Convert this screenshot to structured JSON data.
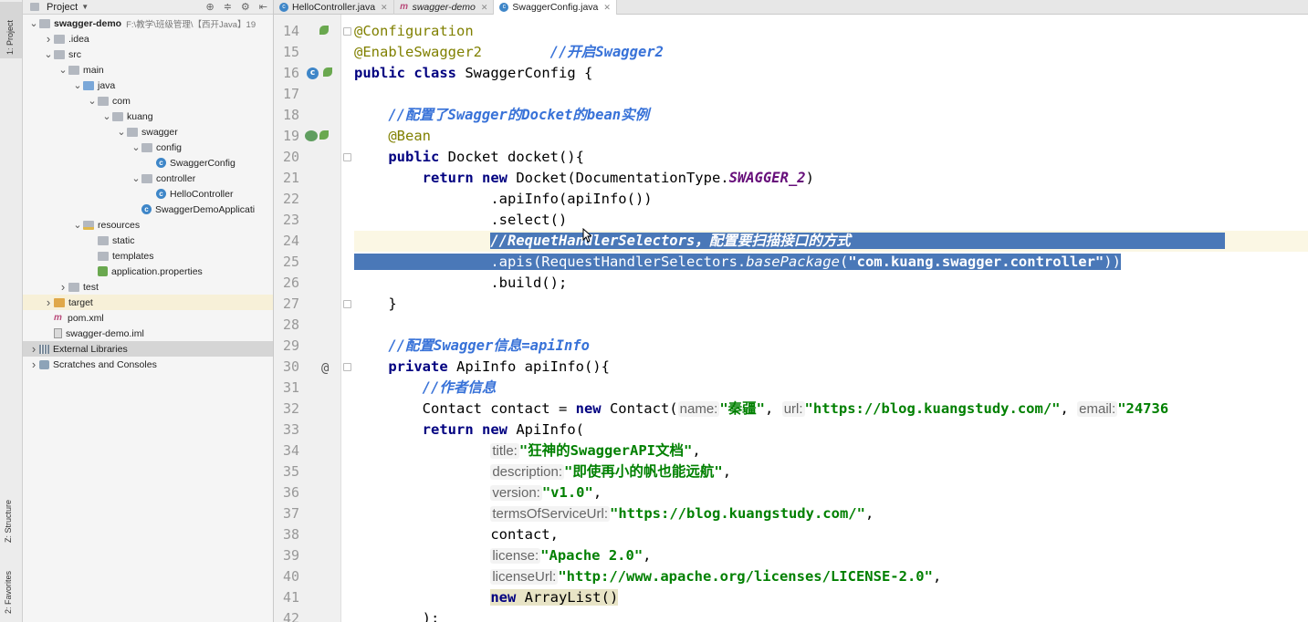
{
  "toolstrip": {
    "project_tab": "1: Project",
    "structure_tab": "Z: Structure",
    "favorites_tab": "2: Favorites"
  },
  "project_panel": {
    "title": "Project",
    "tree": [
      {
        "label": "swagger-demo",
        "path": "F:\\教学\\班级管理\\【西开Java】19",
        "depth": 0,
        "arrow": "down",
        "icon": "folder-icon"
      },
      {
        "label": ".idea",
        "depth": 1,
        "arrow": "right",
        "icon": "folder-icon"
      },
      {
        "label": "src",
        "depth": 1,
        "arrow": "down",
        "icon": "folder-icon"
      },
      {
        "label": "main",
        "depth": 2,
        "arrow": "down",
        "icon": "folder-icon"
      },
      {
        "label": "java",
        "depth": 3,
        "arrow": "down",
        "icon": "source-folder-icon"
      },
      {
        "label": "com",
        "depth": 4,
        "arrow": "down",
        "icon": "package-icon"
      },
      {
        "label": "kuang",
        "depth": 5,
        "arrow": "down",
        "icon": "package-icon"
      },
      {
        "label": "swagger",
        "depth": 6,
        "arrow": "down",
        "icon": "package-icon"
      },
      {
        "label": "config",
        "depth": 7,
        "arrow": "down",
        "icon": "package-icon"
      },
      {
        "label": "SwaggerConfig",
        "depth": 8,
        "arrow": "",
        "icon": "class-icon"
      },
      {
        "label": "controller",
        "depth": 7,
        "arrow": "down",
        "icon": "package-icon"
      },
      {
        "label": "HelloController",
        "depth": 8,
        "arrow": "",
        "icon": "class-icon"
      },
      {
        "label": "SwaggerDemoApplicati",
        "depth": 7,
        "arrow": "",
        "icon": "spring-class-icon"
      },
      {
        "label": "resources",
        "depth": 3,
        "arrow": "down",
        "icon": "resources-folder-icon"
      },
      {
        "label": "static",
        "depth": 4,
        "arrow": "",
        "icon": "folder-icon"
      },
      {
        "label": "templates",
        "depth": 4,
        "arrow": "",
        "icon": "folder-icon"
      },
      {
        "label": "application.properties",
        "depth": 4,
        "arrow": "",
        "icon": "properties-icon"
      },
      {
        "label": "test",
        "depth": 2,
        "arrow": "right",
        "icon": "folder-icon"
      },
      {
        "label": "target",
        "depth": 1,
        "arrow": "right",
        "icon": "target-folder-icon"
      },
      {
        "label": "pom.xml",
        "depth": 1,
        "arrow": "",
        "icon": "maven-icon"
      },
      {
        "label": "swagger-demo.iml",
        "depth": 1,
        "arrow": "",
        "icon": "iml-file-icon"
      },
      {
        "label": "External Libraries",
        "depth": 0,
        "arrow": "right",
        "icon": "libraries-icon"
      },
      {
        "label": "Scratches and Consoles",
        "depth": 0,
        "arrow": "right",
        "icon": "scratches-icon"
      }
    ]
  },
  "tabs": [
    {
      "label": "HelloController.java",
      "icon": "class-icon",
      "active": false
    },
    {
      "label": "swagger-demo",
      "icon": "maven-icon",
      "active": false
    },
    {
      "label": "SwaggerConfig.java",
      "icon": "class-icon",
      "active": true
    }
  ],
  "editor": {
    "line_numbers": [
      "14",
      "15",
      "16",
      "17",
      "18",
      "19",
      "20",
      "21",
      "22",
      "23",
      "24",
      "25",
      "26",
      "27",
      "28",
      "29",
      "30",
      "31",
      "32",
      "33",
      "34",
      "35",
      "36",
      "37",
      "38",
      "39",
      "40",
      "41",
      "42"
    ],
    "code": {
      "l14": "@Configuration",
      "l15_ann": "@EnableSwagger2",
      "l15_cm": "//开启Swagger2",
      "l16_kw1": "public",
      "l16_kw2": "class",
      "l16_rest": " SwaggerConfig {",
      "l18_cm": "//配置了Swagger的Docket的bean实例",
      "l19_ann": "@Bean",
      "l20_kw": "public",
      "l20_rest": " Docket docket(){",
      "l21_kw1": "return",
      "l21_kw2": "new",
      "l21_rest1": " Docket(DocumentationType.",
      "l21_field": "SWAGGER_2",
      "l21_rest2": ")",
      "l22": ".apiInfo(apiInfo())",
      "l23": ".select()",
      "l24_cm_a": "//Reque",
      "l24_cm_b": "tHandlerSelectors，配置要扫描接口的方式",
      "l25_a": ".apis(RequestHandlerSelectors.",
      "l25_it": "basePackage",
      "l25_b": "(",
      "l25_str": "\"com.kuang.swagger.controller\"",
      "l25_c": "))",
      "l26": ".build();",
      "l27": "}",
      "l29_cm": "//配置Swagger信息=apiInfo",
      "l30_kw": "private",
      "l30_rest": " ApiInfo apiInfo(){",
      "l31_cm": "//作者信息",
      "l32_a": "Contact contact = ",
      "l32_kw": "new",
      "l32_b": " Contact(",
      "l32_hint1": "name:",
      "l32_str1": "\"秦疆\"",
      "l32_sep1": ", ",
      "l32_hint2": "url:",
      "l32_str2": "\"https://blog.kuangstudy.com/\"",
      "l32_sep2": ", ",
      "l32_hint3": "email:",
      "l32_str3": "\"24736",
      "l33_kw1": "return",
      "l33_kw2": "new",
      "l33_rest": " ApiInfo(",
      "l34_hint": "title:",
      "l34_str": "\"狂神的SwaggerAPI文档\"",
      "l35_hint": "description:",
      "l35_str": "\"即使再小的帆也能远航\"",
      "l36_hint": "version:",
      "l36_str": "\"v1.0\"",
      "l37_hint": "termsOfServiceUrl:",
      "l37_str": "\"https://blog.kuangstudy.com/\"",
      "l38": "contact,",
      "l39_hint": "license:",
      "l39_str": "\"Apache 2.0\"",
      "l40_hint": "licenseUrl:",
      "l40_str": "\"http://www.apache.org/licenses/LICENSE-2.0\"",
      "l41_kw": "new",
      "l41_rest": " ArrayList()",
      "l42": ");",
      "comma": ","
    }
  },
  "colors": {
    "selection": "#4a78b8",
    "keyword": "#000080",
    "comment": "#3872d8",
    "string": "#008000",
    "annotation": "#808000"
  }
}
